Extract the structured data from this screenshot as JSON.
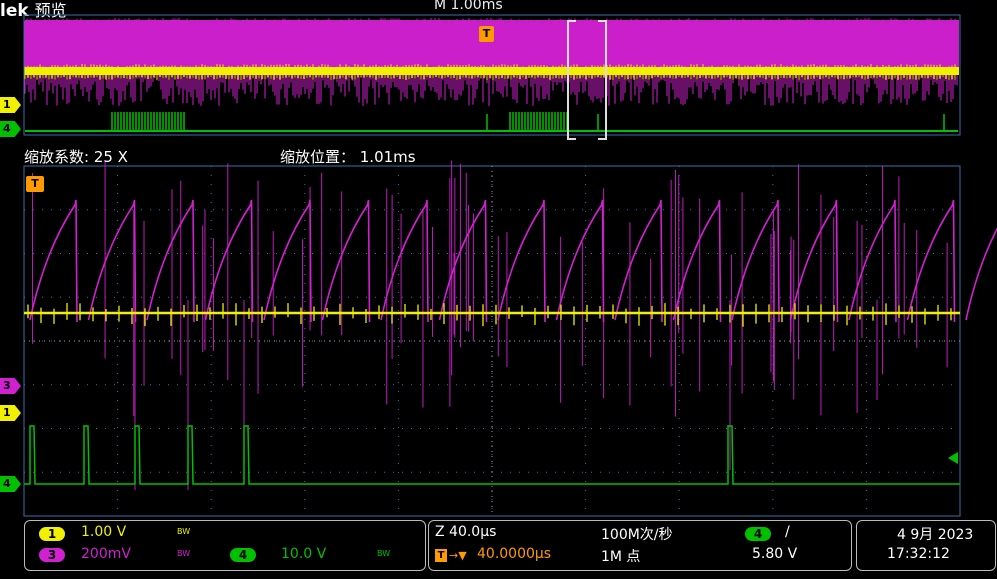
{
  "header": {
    "brand": "lek",
    "mode": "预览",
    "timebase": "M 1.00ms"
  },
  "zoom": {
    "factor_label": "缩放系数: 25 X",
    "position_label": "缩放位置： 1.01ms"
  },
  "markers": {
    "trigger": "T",
    "ch1": "1",
    "ch3": "3",
    "ch4": "4"
  },
  "channels": {
    "ch1": {
      "badge": "1",
      "scale": "1.00 V",
      "bw": "BW",
      "color": "#f0f000"
    },
    "ch3": {
      "badge": "3",
      "scale": "200mV",
      "bw": "BW",
      "color": "#d020d0"
    },
    "ch4": {
      "badge": "4",
      "scale": "10.0 V",
      "bw": "BW",
      "color": "#00c000"
    }
  },
  "timing": {
    "zoom_scale": "Z 40.0µs",
    "trigger_offset": "40.0000µs",
    "sample_rate": "100M次/秒",
    "record_length": "1M 点"
  },
  "trigger_info": {
    "source_badge": "4",
    "slope": "/",
    "level": "5.80 V"
  },
  "datetime": {
    "date": "4 9月 2023",
    "time": "17:32:12"
  },
  "colors": {
    "grid": "#3a6fa8",
    "ch1": "#f0f000",
    "ch3": "#d020d0",
    "ch4": "#00c000",
    "trigger": "#ff9a00",
    "status_border": "#bbbbbb"
  }
}
